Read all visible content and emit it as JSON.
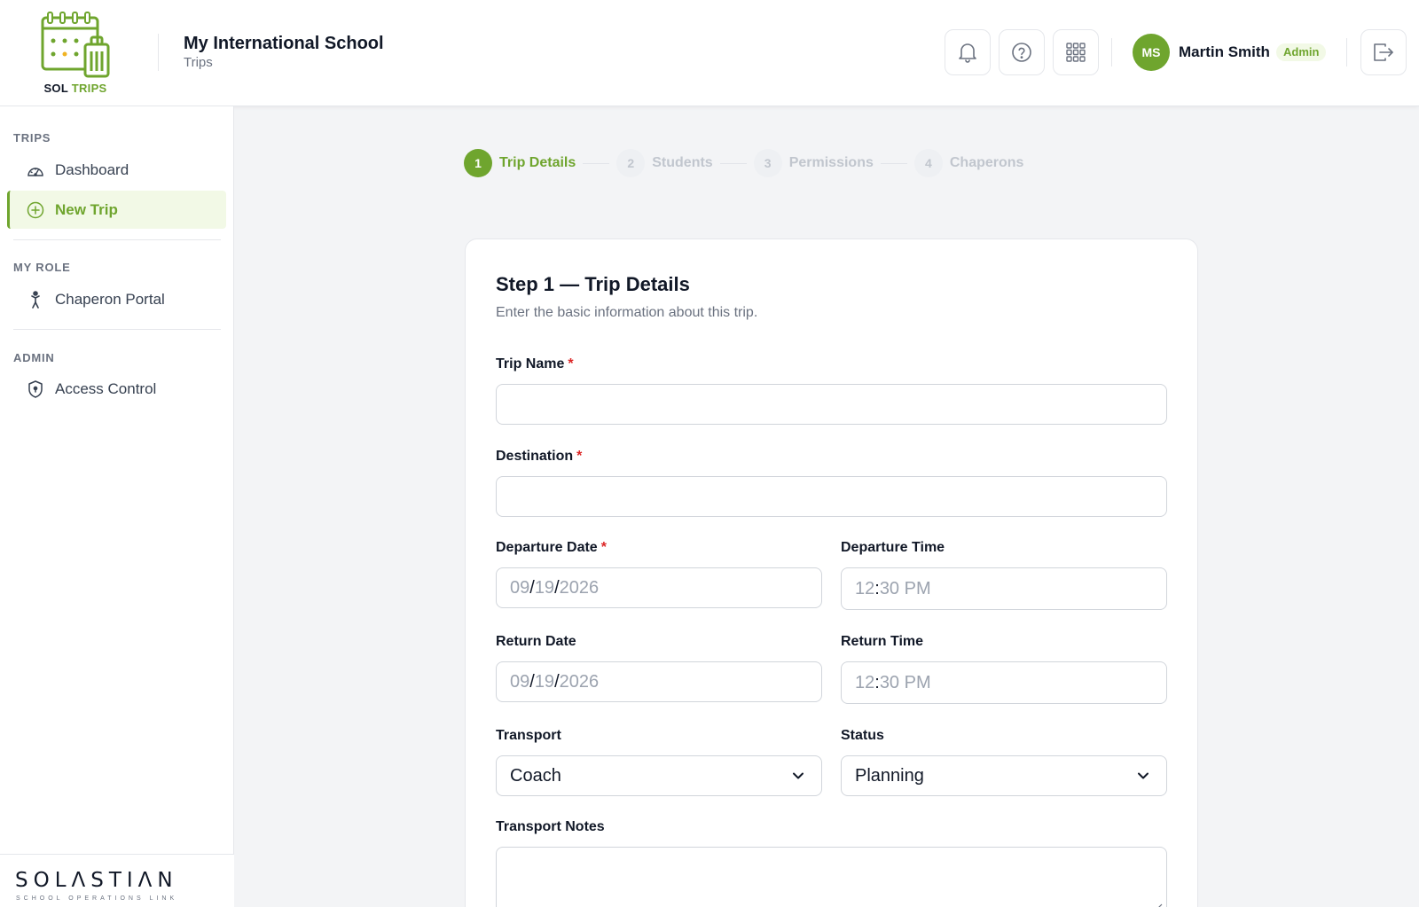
{
  "logo": {
    "text_sol": "SOL",
    "text_trips": "TRIPS",
    "icon": "calendar-suitcase-icon"
  },
  "header": {
    "school_name": "My International School",
    "section": "Trips",
    "buttons": [
      {
        "icon": "bell-icon"
      },
      {
        "icon": "help-icon"
      },
      {
        "icon": "apps-grid-icon"
      },
      {
        "icon": "logout-icon"
      }
    ],
    "user": {
      "initials": "MS",
      "name": "Martin Smith",
      "role": "Admin"
    }
  },
  "sidebar": {
    "sections": [
      {
        "title": "TRIPS",
        "items": [
          {
            "label": "Dashboard",
            "icon": "gauge-icon"
          },
          {
            "label": "New Trip",
            "icon": "plus-circle-icon",
            "active": true
          }
        ]
      },
      {
        "title": "MY ROLE",
        "items": [
          {
            "label": "Chaperon Portal",
            "icon": "person-icon"
          }
        ]
      },
      {
        "title": "ADMIN",
        "items": [
          {
            "label": "Access Control",
            "icon": "shield-icon"
          }
        ]
      }
    ],
    "footer": {
      "brand": "SOLΛSTIΛN",
      "tagline": "SCHOOL OPERATIONS LINK"
    }
  },
  "stepper": [
    {
      "num": "1",
      "label": "Trip Details",
      "active": true
    },
    {
      "num": "2",
      "label": "Students"
    },
    {
      "num": "3",
      "label": "Permissions"
    },
    {
      "num": "4",
      "label": "Chaperons"
    }
  ],
  "form": {
    "title": "Step 1 — Trip Details",
    "subtitle": "Enter the basic information about this trip.",
    "required_mark": "*",
    "trip_name": {
      "label": "Trip Name",
      "value": ""
    },
    "destination": {
      "label": "Destination",
      "value": ""
    },
    "departure_date": {
      "label": "Departure Date",
      "mm": "09",
      "dd": "19",
      "yyyy": "2026",
      "sep": "/"
    },
    "departure_time": {
      "label": "Departure Time",
      "hh": "12",
      "mm": "30",
      "ampm": "PM",
      "sep": ":"
    },
    "return_date": {
      "label": "Return Date",
      "mm": "09",
      "dd": "19",
      "yyyy": "2026",
      "sep": "/"
    },
    "return_time": {
      "label": "Return Time",
      "hh": "12",
      "mm": "30",
      "ampm": "PM",
      "sep": ":"
    },
    "transport": {
      "label": "Transport",
      "value": "Coach"
    },
    "status": {
      "label": "Status",
      "value": "Planning"
    },
    "transport_notes": {
      "label": "Transport Notes",
      "value": ""
    }
  },
  "colors": {
    "accent": "#6fa52e",
    "accent_bg": "#f2f9e6",
    "required": "#dc2626"
  }
}
